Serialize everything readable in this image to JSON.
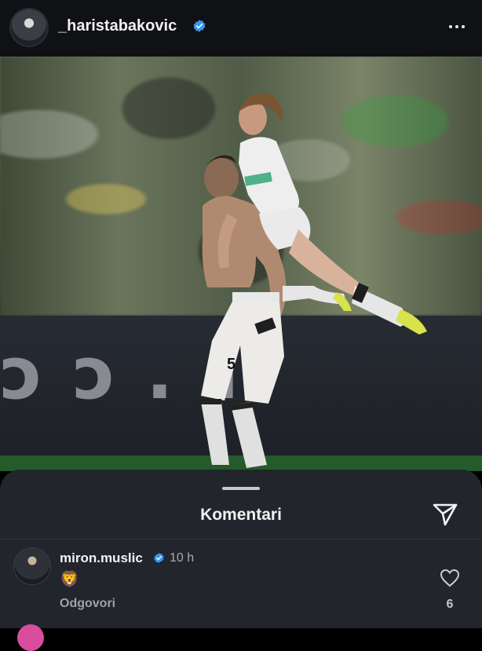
{
  "post": {
    "username": "_haristabakovic",
    "verified": true,
    "more_icon": "more-horizontal-icon",
    "image": {
      "jersey_number": "5",
      "board_text": "ɔ ɔ . ı"
    }
  },
  "comments_sheet": {
    "title": "Komentari",
    "share_icon": "send-icon",
    "comments": [
      {
        "username": "miron.muslic",
        "verified": true,
        "time": "10 h",
        "text": "🦁",
        "reply_label": "Odgovori",
        "likes": "6"
      }
    ]
  },
  "colors": {
    "accent_verified": "#3897f0",
    "sheet_bg": "#22252b",
    "header_bg": "#101114"
  }
}
